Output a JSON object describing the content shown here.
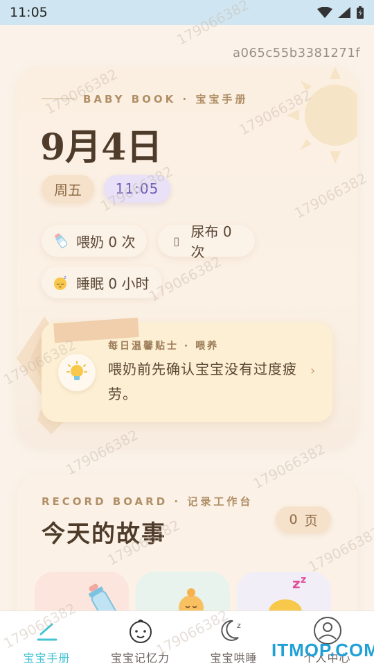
{
  "status_bar": {
    "time": "11:05"
  },
  "device_id": "a065c55b3381271f",
  "hero": {
    "brand": "BABY BOOK · 宝宝手册",
    "date": "9月4日",
    "weekday": "周五",
    "time": "11:05",
    "stats": {
      "feed": "喂奶 0 次",
      "diaper": "尿布 0 次",
      "diaper_icon_glyph": "▯",
      "sleep": "睡眠 0 小时"
    },
    "tip": {
      "label": "每日温馨贴士 · 喂养",
      "text": "喂奶前先确认宝宝没有过度疲劳。",
      "chevron": "›"
    }
  },
  "record": {
    "label": "RECORD BOARD · 记录工作台",
    "title": "今天的故事",
    "page_count": "0",
    "page_unit": "页"
  },
  "tabbar": {
    "tabs": [
      {
        "label": "宝宝手册",
        "icon": "pen-icon",
        "active": true
      },
      {
        "label": "宝宝记忆力",
        "icon": "baby-face-icon",
        "active": false
      },
      {
        "label": "宝宝哄睡",
        "icon": "moon-icon",
        "active": false
      },
      {
        "label": "个人中心",
        "icon": "user-icon",
        "active": false
      }
    ]
  },
  "watermark": "179066382",
  "site_logo": "ITMOP.COM",
  "colors": {
    "accent": "#45c3d3",
    "brand_text": "#b08f66",
    "title_text": "#4e3b2a"
  }
}
